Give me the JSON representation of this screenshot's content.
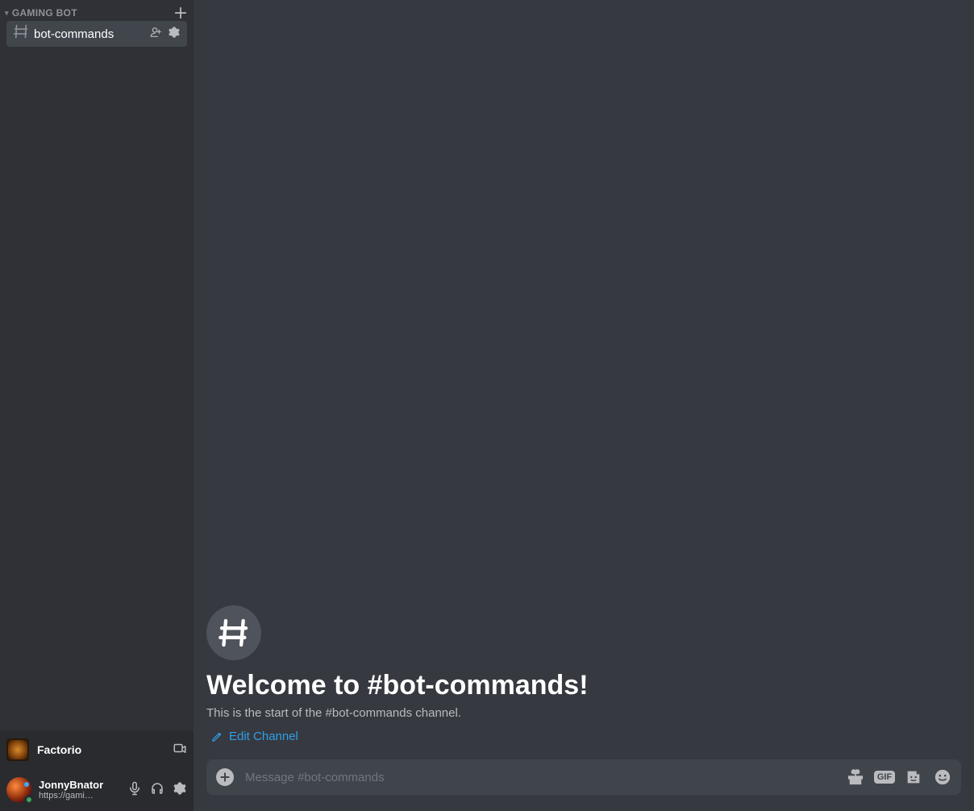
{
  "sidebar": {
    "category": "GAMING BOT",
    "channel": {
      "name": "bot-commands"
    }
  },
  "game": {
    "name": "Factorio"
  },
  "user": {
    "name": "JonnyBnator",
    "status": "https://gami…"
  },
  "welcome": {
    "title": "Welcome to #bot-commands!",
    "subtitle": "This is the start of the #bot-commands channel.",
    "edit": "Edit Channel"
  },
  "composer": {
    "placeholder": "Message #bot-commands",
    "gif": "GIF"
  }
}
